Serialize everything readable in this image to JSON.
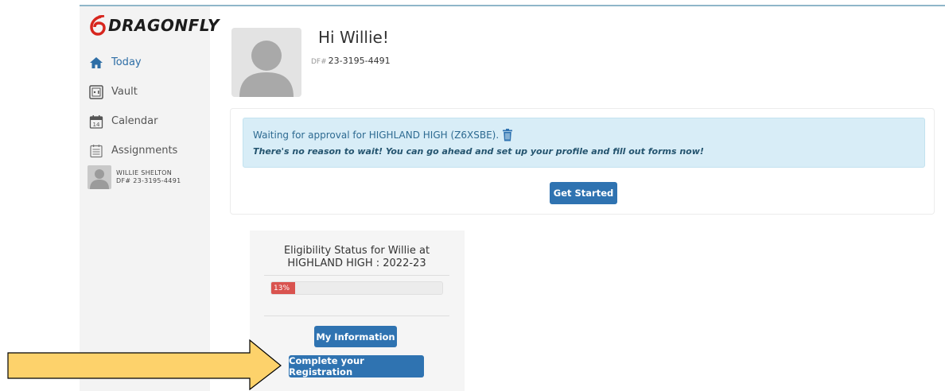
{
  "app": {
    "logo_text": "DRAGONFLY"
  },
  "sidebar": {
    "items": [
      {
        "label": "Today",
        "icon": "home-icon",
        "active": true
      },
      {
        "label": "Vault",
        "icon": "vault-icon",
        "active": false
      },
      {
        "label": "Calendar",
        "icon": "calendar-icon",
        "calendar_day": "14",
        "active": false
      },
      {
        "label": "Assignments",
        "icon": "assignments-icon",
        "active": false
      }
    ],
    "user": {
      "name": "WILLIE SHELTON",
      "df_number": "DF# 23-3195-4491"
    }
  },
  "header": {
    "greeting": "Hi Willie!",
    "df_prefix": "DF#",
    "df_number": "23-3195-4491"
  },
  "alert": {
    "message": "Waiting for approval for HIGHLAND HIGH (Z6XSBE).",
    "subtext": "There's no reason to wait! You can go ahead and set up your profile and fill out forms now!"
  },
  "card": {
    "get_started_label": "Get Started"
  },
  "eligibility": {
    "title": "Eligibility Status for Willie at HIGHLAND HIGH : 2022-23",
    "progress_percent": 13,
    "progress_label": "13%",
    "my_information_label": "My Information",
    "complete_registration_label": "Complete your Registration"
  },
  "colors": {
    "accent": "#2f73b1",
    "alert_bg": "#d8edf7",
    "progress_fill": "#d9534f",
    "arrow_fill": "#fdd26b",
    "sidebar_bg": "#f3f3f3"
  }
}
